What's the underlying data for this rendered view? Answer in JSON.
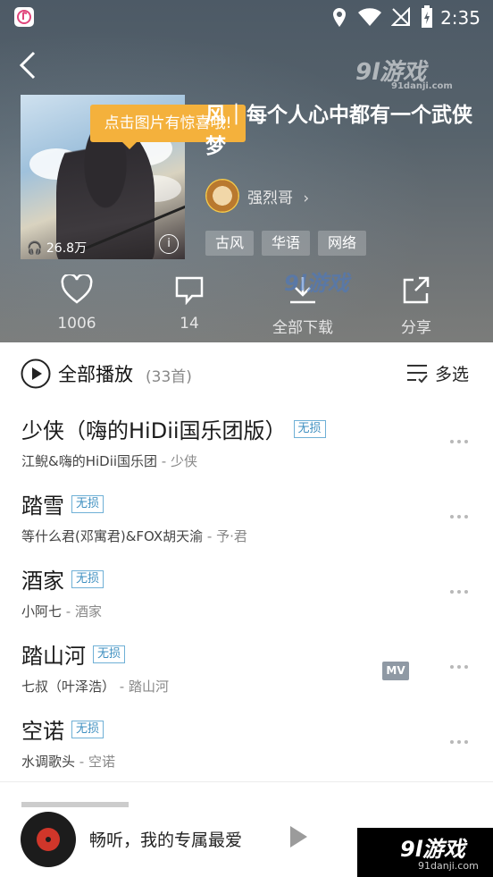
{
  "status": {
    "time": "2:35"
  },
  "playlist": {
    "title": "风｜每个人心中都有一个武侠梦",
    "tooltip": "点击图片有惊喜哦!",
    "play_count": "26.8万",
    "author": "强烈哥",
    "tags": [
      "古风",
      "华语",
      "网络"
    ]
  },
  "actions": {
    "like_count": "1006",
    "comment_count": "14",
    "download_label": "全部下载",
    "share_label": "分享"
  },
  "list_header": {
    "play_all": "全部播放",
    "count": "(33首)",
    "multi_select": "多选"
  },
  "songs": [
    {
      "name": "少侠（嗨的HiDii国乐团版）",
      "badge": "无损",
      "artist": "江鲵&嗨的HiDii国乐团",
      "album": " - 少侠",
      "mv": ""
    },
    {
      "name": "踏雪",
      "badge": "无损",
      "artist": "等什么君(邓寓君)&FOX胡天渝",
      "album": " - 予·君",
      "mv": ""
    },
    {
      "name": "酒家",
      "badge": "无损",
      "artist": "小阿七",
      "album": " - 酒家",
      "mv": ""
    },
    {
      "name": "踏山河",
      "badge": "无损",
      "artist": "七叔（叶泽浩）",
      "album": " - 踏山河",
      "mv": "MV"
    },
    {
      "name": "空诺",
      "badge": "无损",
      "artist": "水调歌头",
      "album": " - 空诺",
      "mv": ""
    }
  ],
  "player": {
    "now_playing": "畅听，我的专属最爱"
  },
  "watermark": {
    "text": "9l游戏",
    "url": "91danji.com"
  }
}
